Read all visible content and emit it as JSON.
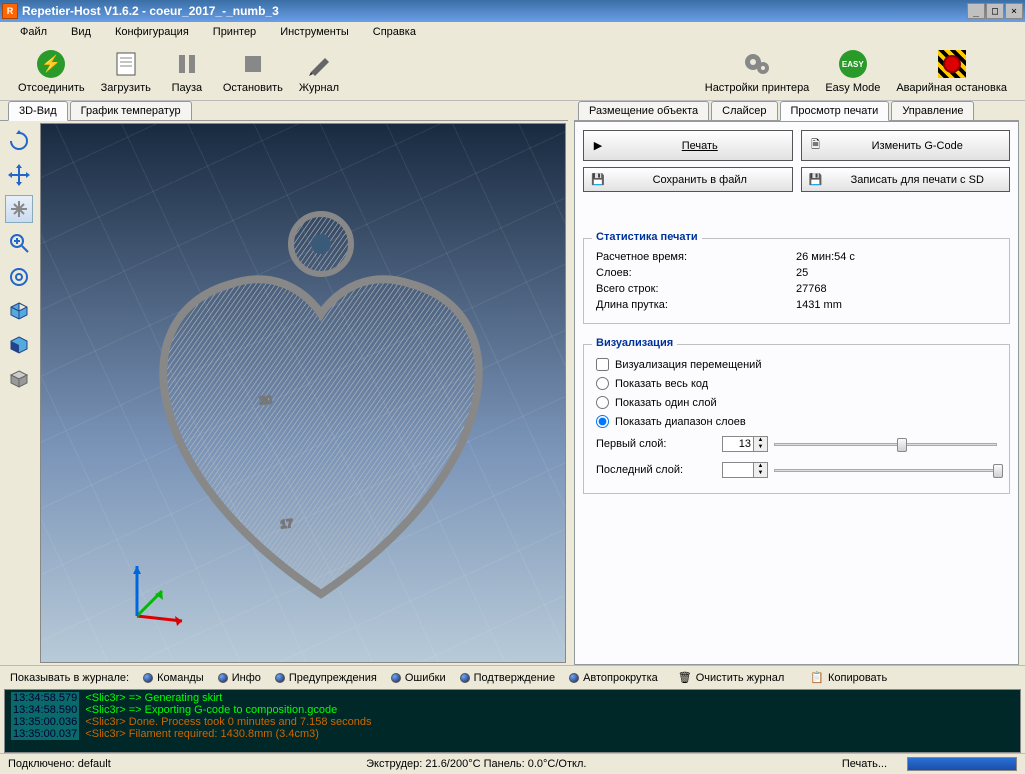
{
  "title": "Repetier-Host V1.6.2 - coeur_2017_-_numb_3",
  "menus": [
    "Файл",
    "Вид",
    "Конфигурация",
    "Принтер",
    "Инструменты",
    "Справка"
  ],
  "toolbar": {
    "disconnect": "Отсоединить",
    "load": "Загрузить",
    "pause": "Пауза",
    "stop": "Остановить",
    "log": "Журнал",
    "printer_settings": "Настройки принтера",
    "easy": "Easy Mode",
    "emergency": "Аварийная остановка"
  },
  "leftTabs": {
    "view3d": "3D-Вид",
    "tempGraph": "График температур"
  },
  "rightTabs": {
    "placement": "Размещение объекта",
    "slicer": "Слайсер",
    "preview": "Просмотр печати",
    "control": "Управление"
  },
  "buttons": {
    "print": "Печать",
    "editGcode": "Изменить G-Code",
    "saveFile": "Сохранить в файл",
    "saveSd": "Записать для печати с SD"
  },
  "stats": {
    "legend": "Статистика печати",
    "time_k": "Расчетное время:",
    "time_v": "26 мин:54 с",
    "layers_k": "Слоев:",
    "layers_v": "25",
    "lines_k": "Всего строк:",
    "lines_v": "27768",
    "filament_k": "Длина прутка:",
    "filament_v": "1431 mm"
  },
  "viz": {
    "legend": "Визуализация",
    "travel": "Визуализация перемещений",
    "all": "Показать весь код",
    "single": "Показать один слой",
    "range": "Показать диапазон слоев",
    "first_k": "Первый слой:",
    "first_v": "13",
    "last_k": "Последний слой:",
    "last_v": ""
  },
  "logFilter": {
    "label": "Показывать в журнале:",
    "cmds": "Команды",
    "info": "Инфо",
    "warn": "Предупреждения",
    "err": "Ошибки",
    "ack": "Подтверждение",
    "auto": "Автопрокрутка",
    "clear": "Очистить журнал",
    "copy": "Копировать"
  },
  "log": [
    {
      "ts": "13:34:58.579",
      "txt": "<Slic3r> => Generating skirt",
      "cls": ""
    },
    {
      "ts": "13:34:58.590",
      "txt": "<Slic3r> => Exporting G-code to composition.gcode",
      "cls": ""
    },
    {
      "ts": "13:35:00.036",
      "txt": "<Slic3r> Done. Process took 0 minutes and 7.158 seconds",
      "cls": "darkorange"
    },
    {
      "ts": "13:35:00.037",
      "txt": "<Slic3r> Filament required: 1430.8mm (3.4cm3)",
      "cls": "darkorange"
    }
  ],
  "status": {
    "conn": "Подключено: default",
    "extruder": "Экструдер: 21.6/200°C Панель: 0.0°C/Откл.",
    "idle": "Печать..."
  }
}
